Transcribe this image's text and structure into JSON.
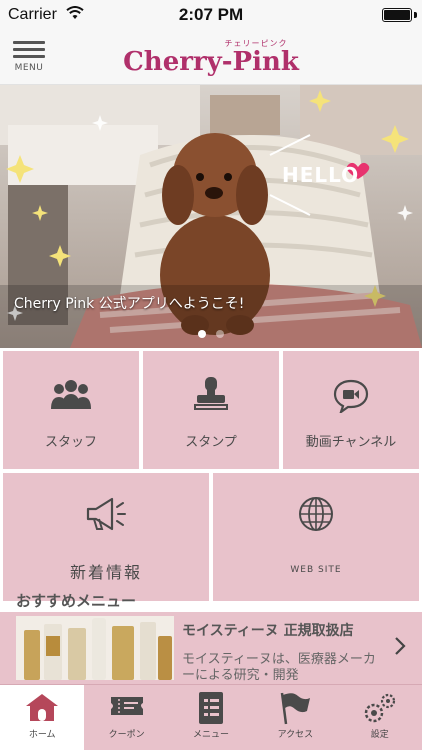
{
  "status": {
    "carrier": "Carrier",
    "time": "2:07 PM"
  },
  "header": {
    "menu_label": "MENU",
    "logo_text": "Cherry-Pink",
    "logo_kana": "チェリーピンク"
  },
  "hero": {
    "overlay_text": "HELLO",
    "caption": "Cherry Pink 公式アプリへようこそ!"
  },
  "tiles": [
    {
      "label": "スタッフ",
      "icon": "staff-icon"
    },
    {
      "label": "スタンプ",
      "icon": "stamp-icon"
    },
    {
      "label": "動画チャンネル",
      "icon": "video-channel-icon"
    },
    {
      "label": "新着情報",
      "icon": "megaphone-icon"
    },
    {
      "label": "WEB SITE",
      "icon": "globe-icon"
    }
  ],
  "recommend": {
    "title": "おすすめメニュー",
    "item": {
      "name": "モイスティーヌ 正規取扱店",
      "desc": "モイスティーヌは、医療器メーカーによる研究・開発"
    }
  },
  "tabbar": {
    "items": [
      {
        "label": "ホーム",
        "icon": "home-icon"
      },
      {
        "label": "クーポン",
        "icon": "coupon-icon"
      },
      {
        "label": "メニュー",
        "icon": "menu-book-icon"
      },
      {
        "label": "アクセス",
        "icon": "flag-icon"
      },
      {
        "label": "設定",
        "icon": "settings-gears-icon"
      }
    ]
  },
  "colors": {
    "brand": "#b0306b",
    "tile": "#e8c2cb",
    "icon": "#4a4a4a"
  }
}
